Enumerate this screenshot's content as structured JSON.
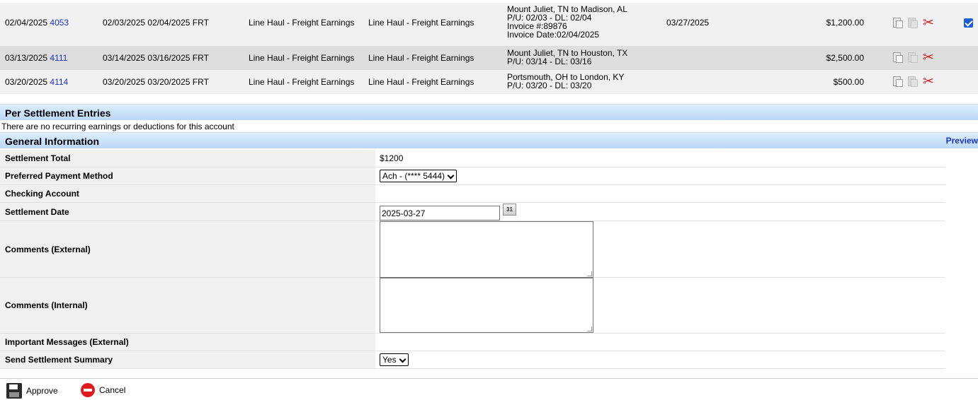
{
  "entries": [
    {
      "date": "02/04/2025",
      "id": "4053",
      "dates": "02/03/2025 02/04/2025 FRT",
      "desc1": "Line Haul - Freight Earnings",
      "desc2": "Line Haul - Freight Earnings",
      "route": [
        "Mount Juliet, TN to Madison, AL",
        "P/U: 02/03 - DL: 02/04",
        "Invoice #:89876",
        "Invoice Date:02/04/2025"
      ],
      "pay_date": "03/27/2025",
      "amount": "$1,200.00",
      "checked": true
    },
    {
      "date": "03/13/2025",
      "id": "4111",
      "dates": "03/14/2025 03/16/2025 FRT",
      "desc1": "Line Haul - Freight Earnings",
      "desc2": "Line Haul - Freight Earnings",
      "route": [
        "Mount Juliet, TN to Houston, TX",
        "P/U: 03/14 - DL: 03/16"
      ],
      "pay_date": "",
      "amount": "$2,500.00",
      "checked": false
    },
    {
      "date": "03/20/2025",
      "id": "4114",
      "dates": "03/20/2025 03/20/2025 FRT",
      "desc1": "Line Haul - Freight Earnings",
      "desc2": "Line Haul - Freight Earnings",
      "route": [
        "Portsmouth, OH to London, KY",
        "P/U: 03/20 - DL: 03/20"
      ],
      "pay_date": "",
      "amount": "$500.00",
      "checked": false
    }
  ],
  "per_settlement": {
    "title": "Per Settlement Entries",
    "empty_message": "There are no recurring earnings or deductions for this account"
  },
  "general": {
    "title": "General Information",
    "preview_label": "Preview",
    "settlement_total_label": "Settlement Total",
    "settlement_total_value": "$1200",
    "payment_method_label": "Preferred Payment Method",
    "payment_method_value": "Ach - (**** 5444)",
    "checking_account_label": "Checking Account",
    "settlement_date_label": "Settlement Date",
    "settlement_date_value": "2025-03-27",
    "calendar_glyph": "31",
    "comments_external_label": "Comments (External)",
    "comments_internal_label": "Comments (Internal)",
    "important_messages_label": "Important Messages (External)",
    "send_summary_label": "Send Settlement Summary",
    "send_summary_value": "Yes"
  },
  "footer": {
    "approve_label": "Approve",
    "cancel_label": "Cancel"
  },
  "icons": [
    "document-icon",
    "copy-icon",
    "scissors-icon",
    "calendar-icon",
    "save-icon",
    "cancel-icon"
  ],
  "colors": {
    "link": "#1a33c5",
    "section_header": "#bcd9f7",
    "cancel": "#e01a1a",
    "cut": "#d21f1f"
  }
}
